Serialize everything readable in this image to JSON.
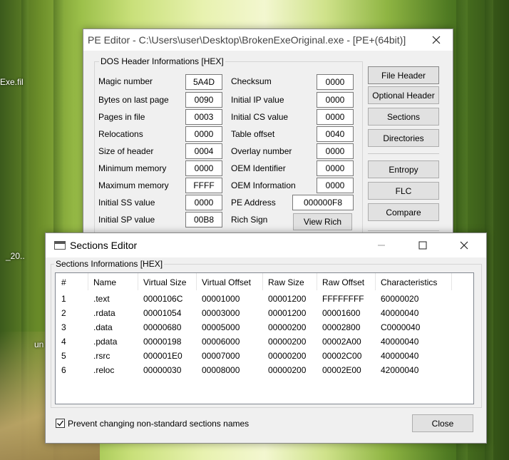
{
  "desktop": {
    "icon_labels": [
      "Exe.fil",
      "_20..",
      "un"
    ]
  },
  "pe_editor": {
    "title": "PE Editor - C:\\Users\\user\\Desktop\\BrokenExeOriginal.exe - [PE+(64bit)]",
    "group_title": "DOS Header Informations [HEX]",
    "left_fields": [
      {
        "label": "Magic number",
        "value": "5A4D"
      },
      {
        "label": "Bytes on last page",
        "value": "0090"
      },
      {
        "label": "Pages in file",
        "value": "0003"
      },
      {
        "label": "Relocations",
        "value": "0000"
      },
      {
        "label": "Size of header",
        "value": "0004"
      },
      {
        "label": "Minimum memory",
        "value": "0000"
      },
      {
        "label": "Maximum memory",
        "value": "FFFF"
      },
      {
        "label": "Initial SS value",
        "value": "0000"
      },
      {
        "label": "Initial SP value",
        "value": "00B8"
      }
    ],
    "right_fields": [
      {
        "label": "Checksum",
        "value": "0000"
      },
      {
        "label": "Initial IP value",
        "value": "0000"
      },
      {
        "label": "Initial CS value",
        "value": "0000"
      },
      {
        "label": "Table offset",
        "value": "0040"
      },
      {
        "label": "Overlay number",
        "value": "0000"
      },
      {
        "label": "OEM Identifier",
        "value": "0000"
      },
      {
        "label": "OEM Information",
        "value": "0000"
      }
    ],
    "pe_address": {
      "label": "PE Address",
      "value": "000000F8"
    },
    "rich_sign": {
      "label": "Rich Sign",
      "button": "View Rich"
    },
    "side_buttons": [
      "File Header",
      "Optional Header",
      "Sections",
      "Directories",
      "Entropy",
      "FLC",
      "Compare"
    ]
  },
  "sections_editor": {
    "title": "Sections Editor",
    "group_title": "Sections Informations [HEX]",
    "columns": [
      "#",
      "Name",
      "Virtual Size",
      "Virtual Offset",
      "Raw Size",
      "Raw Offset",
      "Characteristics"
    ],
    "rows": [
      [
        "1",
        ".text",
        "0000106C",
        "00001000",
        "00001200",
        "FFFFFFFF",
        "60000020"
      ],
      [
        "2",
        ".rdata",
        "00001054",
        "00003000",
        "00001200",
        "00001600",
        "40000040"
      ],
      [
        "3",
        ".data",
        "00000680",
        "00005000",
        "00000200",
        "00002800",
        "C0000040"
      ],
      [
        "4",
        ".pdata",
        "00000198",
        "00006000",
        "00000200",
        "00002A00",
        "40000040"
      ],
      [
        "5",
        ".rsrc",
        "000001E0",
        "00007000",
        "00000200",
        "00002C00",
        "40000040"
      ],
      [
        "6",
        ".reloc",
        "00000030",
        "00008000",
        "00000200",
        "00002E00",
        "42000040"
      ]
    ],
    "checkbox_label": "Prevent changing non-standard sections names",
    "checkbox_checked": true,
    "close_button": "Close"
  }
}
